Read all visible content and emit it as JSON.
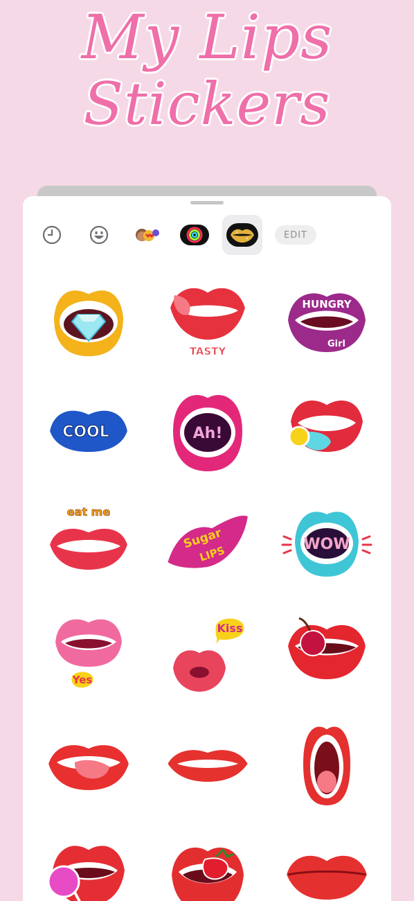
{
  "header": {
    "title_line1": "My Lips",
    "title_line2": "Stickers"
  },
  "toolbar": {
    "items": [
      {
        "icon": "recents-clock-icon"
      },
      {
        "icon": "emoji-smiley-icon"
      },
      {
        "icon": "memoji-icon"
      },
      {
        "icon": "activity-rings-icon"
      },
      {
        "icon": "gold-lips-icon",
        "selected": true
      }
    ],
    "edit_label": "EDIT"
  },
  "stickers": [
    {
      "name": "gold-lips-diamond",
      "color": "#f4b21b",
      "text": ""
    },
    {
      "name": "red-lips-tongue-tasty",
      "color": "#e6323e",
      "text": "TASTY"
    },
    {
      "name": "purple-lips-hungry-girl",
      "color": "#9c2a8a",
      "text": "HUNGRY",
      "text2": "Girl"
    },
    {
      "name": "blue-lips-cool",
      "color": "#1f57c9",
      "text": "COOL"
    },
    {
      "name": "pink-lips-ah",
      "color": "#e3287a",
      "text": "Ah!"
    },
    {
      "name": "red-lips-candy-tongue",
      "color": "#e22b3c",
      "text": ""
    },
    {
      "name": "red-lips-eat-me",
      "color": "#e8344a",
      "text": "eat me"
    },
    {
      "name": "magenta-lips-sugar-lips",
      "color": "#d42b8a",
      "text": "Sugar",
      "text2": "LIPS"
    },
    {
      "name": "cyan-lips-wow",
      "color": "#3fc6d6",
      "text": "WOW"
    },
    {
      "name": "pink-lips-yes",
      "color": "#f06aa0",
      "text": "Yes"
    },
    {
      "name": "kiss-lips-kiss",
      "color": "#e8445c",
      "text": "Kiss"
    },
    {
      "name": "red-lips-cherry",
      "color": "#e4262f",
      "text": ""
    },
    {
      "name": "red-lips-tongue",
      "color": "#e7302f",
      "text": ""
    },
    {
      "name": "red-lips-smile",
      "color": "#e5322f",
      "text": ""
    },
    {
      "name": "red-lips-open-wide",
      "color": "#e4302e",
      "text": ""
    },
    {
      "name": "red-lips-lollipop",
      "color": "#e52e34",
      "text": ""
    },
    {
      "name": "red-lips-strawberry",
      "color": "#e32e30",
      "text": ""
    },
    {
      "name": "red-lips-closed",
      "color": "#e4312f",
      "text": ""
    }
  ]
}
